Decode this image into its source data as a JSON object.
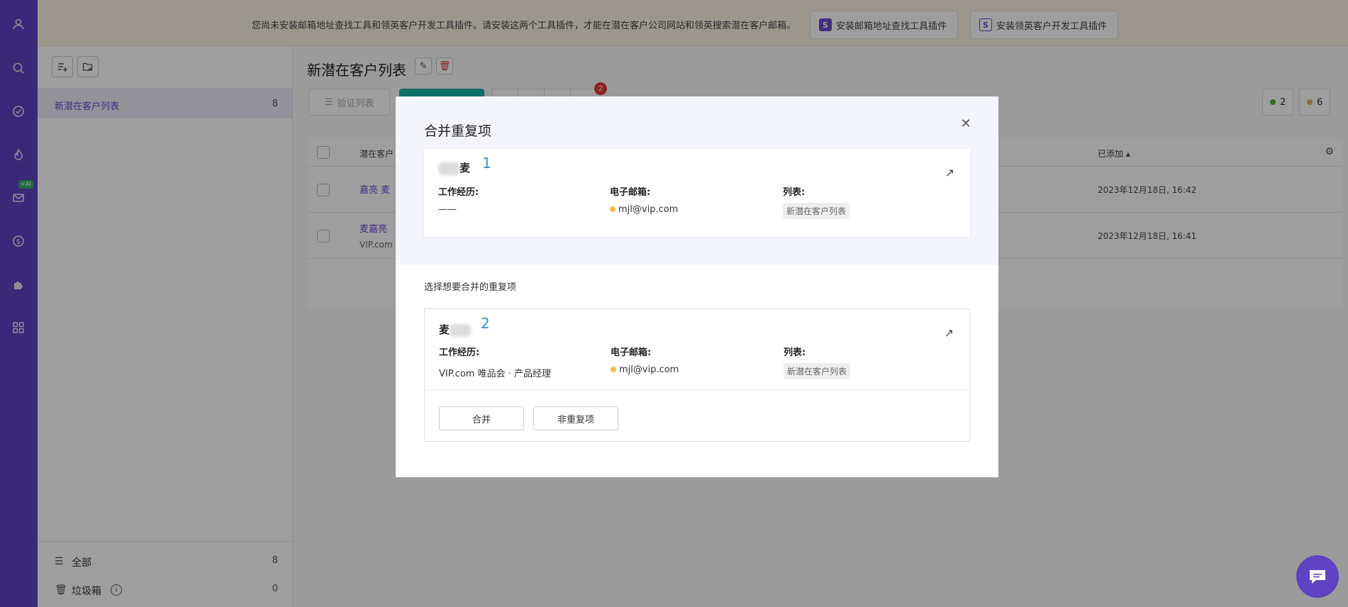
{
  "banner": {
    "text": "您尚未安装邮箱地址查找工具和领英客户开发工具插件。请安装这两个工具插件，才能在潜在客户公司网站和领英搜索潜在客户邮箱。",
    "btn1": "安装邮箱地址查找工具插件",
    "btn2": "安装领英客户开发工具插件"
  },
  "sidebar": {
    "ai_badge": "+AI",
    "icons": [
      "user-icon",
      "search-icon",
      "check-circle-icon",
      "flame-icon",
      "mail-icon",
      "dollar-icon",
      "puzzle-icon",
      "apps-icon"
    ]
  },
  "lists": {
    "active": {
      "name": "新潜在客户列表",
      "count": "8"
    },
    "all": {
      "label": "全部",
      "count": "8"
    },
    "trash": {
      "label": "垃圾箱",
      "count": "0"
    }
  },
  "main": {
    "title": "新潜在客户列表",
    "verify_label": "验证列表",
    "notify_count": "2",
    "status_green": "2",
    "status_orange": "6",
    "col_prospect": "潜在客户（",
    "col_added": "已添加",
    "rows": [
      {
        "name": "嘉亮 麦",
        "sub": "",
        "date": "2023年12月18日, 16:42"
      },
      {
        "name": "麦嘉亮",
        "sub": "VIP.com",
        "date": "2023年12月18日, 16:41"
      }
    ]
  },
  "modal": {
    "title": "合并重复项",
    "choose_label": "选择想要合并的重复项",
    "label_work": "工作经历:",
    "label_email": "电子邮箱:",
    "label_list": "列表:",
    "item1": {
      "name_suffix": "麦",
      "number": "1",
      "work": "——",
      "email": "mjl@vip.com",
      "list": "新潜在客户列表"
    },
    "item2": {
      "name_prefix": "麦",
      "number": "2",
      "work": "VIP.com 唯品会 · 产品经理",
      "email": "mjl@vip.com",
      "list": "新潜在客户列表"
    },
    "merge_btn": "合并",
    "not_dup_btn": "非重复项"
  },
  "colors": {
    "brand": "#5e43c2",
    "teal": "#18b4a5",
    "email_dot": "#f0c04a",
    "number": "#2f8fd8",
    "status_green": "#58b43a",
    "status_orange": "#f0b24a"
  }
}
